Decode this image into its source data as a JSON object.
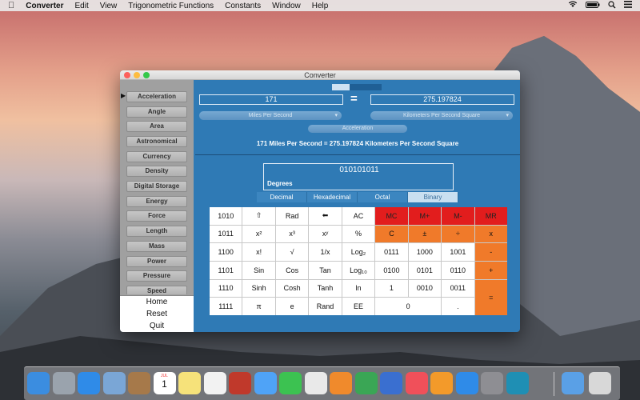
{
  "menubar": {
    "app_name": "Converter",
    "items": [
      "Edit",
      "View",
      "Trigonometric Functions",
      "Constants",
      "Window",
      "Help"
    ]
  },
  "window": {
    "title": "Converter"
  },
  "sidebar": {
    "categories": [
      "Acceleration",
      "Angle",
      "Area",
      "Astronomical",
      "Currency",
      "Density",
      "Digital Storage",
      "Energy",
      "Force",
      "Length",
      "Mass",
      "Power",
      "Pressure",
      "Speed"
    ],
    "selected": "Acceleration",
    "buttons": [
      "Home",
      "Reset",
      "Quit"
    ]
  },
  "converter": {
    "input_value": "171",
    "equals": "=",
    "output_value": "275.197824",
    "from_unit": "Miles Per Second",
    "to_unit": "Kilometers Per Second Square",
    "category": "Acceleration",
    "result_line": "171 Miles Per Second = 275.197824 Kilometers Per Second Square"
  },
  "calculator": {
    "display_value": "010101011",
    "angle_mode": "Degrees",
    "base_tabs": [
      "Decimal",
      "Hexadecimal",
      "Octal",
      "Binary"
    ],
    "active_base": "Binary",
    "keys": [
      {
        "label": "1010",
        "style": "white"
      },
      {
        "label": "⇧",
        "style": "white"
      },
      {
        "label": "Rad",
        "style": "white"
      },
      {
        "label": "⬅",
        "style": "white"
      },
      {
        "label": "AC",
        "style": "white"
      },
      {
        "label": "MC",
        "style": "red"
      },
      {
        "label": "M+",
        "style": "red"
      },
      {
        "label": "M-",
        "style": "red"
      },
      {
        "label": "MR",
        "style": "red"
      },
      {
        "label": "1011",
        "style": "white"
      },
      {
        "label": "x²",
        "style": "white"
      },
      {
        "label": "x³",
        "style": "white"
      },
      {
        "label": "xʸ",
        "style": "white"
      },
      {
        "label": "%",
        "style": "white"
      },
      {
        "label": "C",
        "style": "orange"
      },
      {
        "label": "±",
        "style": "orange"
      },
      {
        "label": "÷",
        "style": "orange"
      },
      {
        "label": "x",
        "style": "orange"
      },
      {
        "label": "1100",
        "style": "white"
      },
      {
        "label": "x!",
        "style": "white"
      },
      {
        "label": "√",
        "style": "white"
      },
      {
        "label": "1/x",
        "style": "white"
      },
      {
        "label": "Log₂",
        "style": "white"
      },
      {
        "label": "0111",
        "style": "white"
      },
      {
        "label": "1000",
        "style": "white"
      },
      {
        "label": "1001",
        "style": "white"
      },
      {
        "label": "-",
        "style": "orange"
      },
      {
        "label": "1101",
        "style": "white"
      },
      {
        "label": "Sin",
        "style": "white"
      },
      {
        "label": "Cos",
        "style": "white"
      },
      {
        "label": "Tan",
        "style": "white"
      },
      {
        "label": "Log₁₀",
        "style": "white"
      },
      {
        "label": "0100",
        "style": "white"
      },
      {
        "label": "0101",
        "style": "white"
      },
      {
        "label": "0110",
        "style": "white"
      },
      {
        "label": "+",
        "style": "orange"
      },
      {
        "label": "1110",
        "style": "white"
      },
      {
        "label": "Sinh",
        "style": "white"
      },
      {
        "label": "Cosh",
        "style": "white"
      },
      {
        "label": "Tanh",
        "style": "white"
      },
      {
        "label": "ln",
        "style": "white"
      },
      {
        "label": "1",
        "style": "white"
      },
      {
        "label": "0010",
        "style": "white"
      },
      {
        "label": "0011",
        "style": "white"
      },
      {
        "label": "1111",
        "style": "white"
      },
      {
        "label": "π",
        "style": "white"
      },
      {
        "label": "e",
        "style": "white"
      },
      {
        "label": "Rand",
        "style": "white"
      },
      {
        "label": "EE",
        "style": "white"
      },
      {
        "label": "0",
        "style": "white"
      },
      {
        "label": ".",
        "style": "white"
      }
    ],
    "equals_key": "="
  },
  "dock": {
    "icons": [
      "finder-icon",
      "launchpad-icon",
      "safari-icon",
      "mail-icon",
      "contacts-icon",
      "calendar-icon",
      "notes-icon",
      "reminders-icon",
      "photo-booth-icon",
      "messages-icon",
      "facetime-icon",
      "photos-icon",
      "pages-icon",
      "numbers-icon",
      "keynote-icon",
      "itunes-icon",
      "ibooks-icon",
      "app-store-icon",
      "system-preferences-icon",
      "converter-icon",
      "downloads-icon",
      "trash-icon"
    ],
    "calendar_month": "JUL",
    "calendar_day": "1",
    "colors": [
      "#3b8de0",
      "#9aa3ad",
      "#2f8be8",
      "#7aa6d6",
      "#a6794a",
      "#ffffff",
      "#f6e27a",
      "#f2f2f2",
      "#c0392b",
      "#4fa3f7",
      "#3cc251",
      "#e9e9e9",
      "#f08a2c",
      "#3aa655",
      "#3a6fd0",
      "#f0505a",
      "#f39a2a",
      "#2f8be8",
      "#8e8e93",
      "#1f8fb4",
      "#5aa0e6",
      "#d8d8d8"
    ]
  }
}
